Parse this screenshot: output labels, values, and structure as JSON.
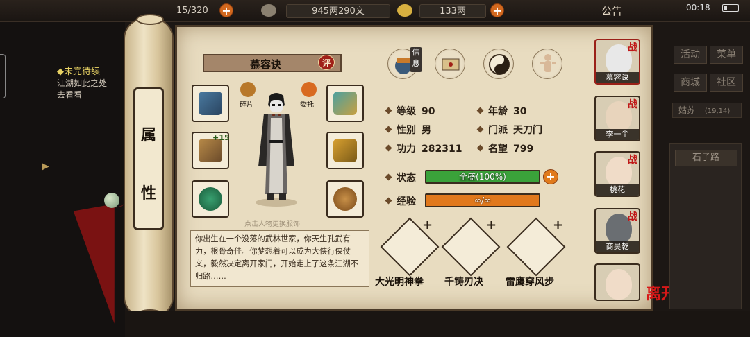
{
  "topbar": {
    "bag": "15/320",
    "money": "945两290文",
    "gold": "133两",
    "announce": "公告",
    "time": "00:18"
  },
  "quest": {
    "title": "◆未完待续",
    "text": "江湖如此之处去看看"
  },
  "scroll": {
    "char1": "属",
    "char2": "性"
  },
  "character": {
    "name": "慕容诀",
    "review": "评",
    "hint": "点击人物更换服饰",
    "bio": "你出生在一个没落的武林世家，你天生孔武有力，根骨奇佳。你梦想着可以成为大侠行侠仗义，毅然决定离开家门，开始走上了这条江湖不归路……"
  },
  "equipment": {
    "enhance": "+15",
    "shard_label": "碎片",
    "entrust_label": "委托"
  },
  "icons": {
    "xinhui": "信息"
  },
  "stats": {
    "level_label": "等级",
    "level": "90",
    "age_label": "年龄",
    "age": "30",
    "gender_label": "性别",
    "gender": "男",
    "sect_label": "门派",
    "sect": "天刀门",
    "power_label": "功力",
    "power": "282311",
    "fame_label": "名望",
    "fame": "799",
    "status_label": "状态",
    "status_text": "全盛(100%)",
    "status_fraction": 1.0,
    "exp_label": "经验",
    "exp_text": "∞/∞",
    "exp_fraction": 1.0
  },
  "skills": [
    {
      "name": "大光明神拳"
    },
    {
      "name": "千铸刃决"
    },
    {
      "name": "雷鹰穿风步"
    }
  ],
  "party": [
    {
      "name": "慕容诀",
      "tag": "战"
    },
    {
      "name": "李一尘",
      "tag": "战"
    },
    {
      "name": "桃花",
      "tag": "战"
    },
    {
      "name": "商昊乾",
      "tag": "战"
    },
    {
      "name": "",
      "tag": ""
    }
  ],
  "leave": "离开",
  "right_panel": {
    "activity": "活动",
    "menu": "菜单",
    "shop": "商城",
    "community": "社区",
    "location": "姑苏",
    "coords": "(19,14)",
    "road": "石子路",
    "btn_a": "信",
    "btn_b": "包"
  },
  "colors": {
    "status_fill": "#3aa23a",
    "exp_fill": "#e0781c",
    "accent_red": "#c01818"
  }
}
